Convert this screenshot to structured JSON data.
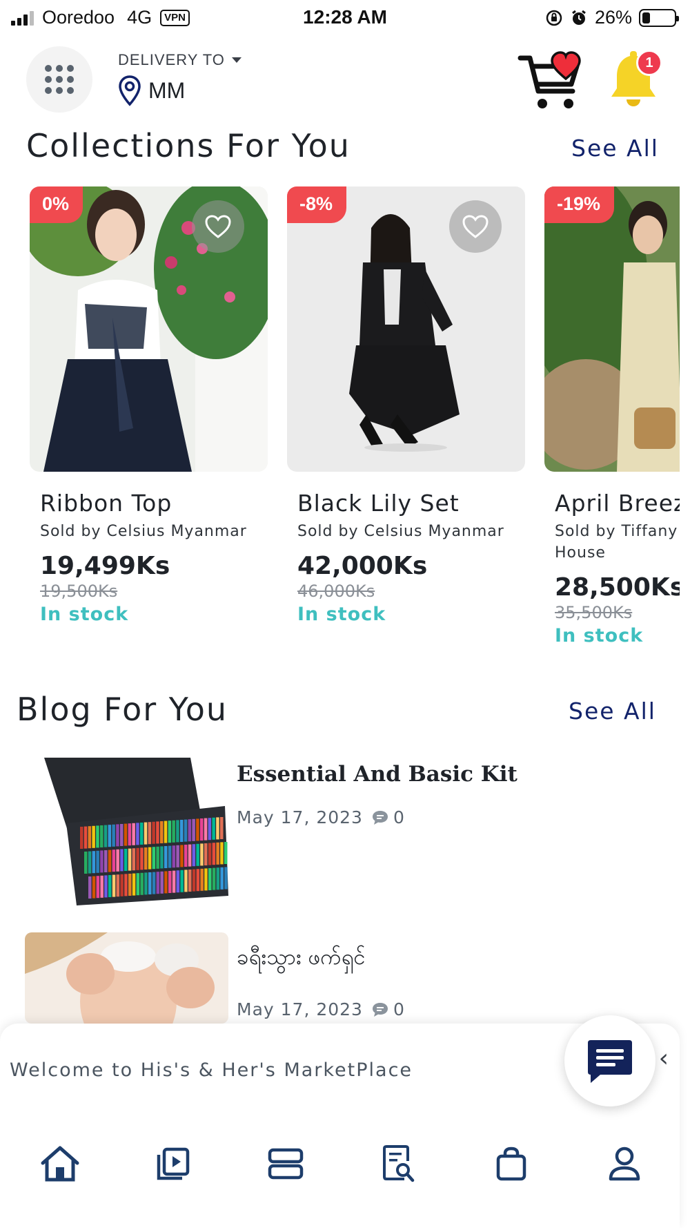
{
  "status_bar": {
    "carrier": "Ooredoo",
    "network": "4G",
    "vpn": "VPN",
    "time": "12:28 AM",
    "battery": "26%",
    "battery_level": 0.26
  },
  "header": {
    "delivery_label": "DELIVERY TO",
    "location": "MM",
    "notification_count": "1"
  },
  "collections": {
    "title": "Collections For You",
    "see_all": "See All",
    "items": [
      {
        "discount": "0%",
        "name": "Ribbon Top",
        "seller": "Sold by  Celsius Myanmar",
        "price": "19,499Ks",
        "old_price": "19,500Ks",
        "stock": "In stock"
      },
      {
        "discount": "-8%",
        "name": "Black Lily Set",
        "seller": "Sold by  Celsius Myanmar",
        "price": "42,000Ks",
        "old_price": "46,000Ks",
        "stock": "In stock"
      },
      {
        "discount": "-19%",
        "name": "April Breez",
        "seller": "Sold by Tiffany House",
        "price": "28,500Ks",
        "old_price": "35,500Ks",
        "stock": "In stock"
      }
    ]
  },
  "blog": {
    "title": "Blog For You",
    "see_all": "See All",
    "items": [
      {
        "title": "Essential And Basic Kit",
        "date": "May 17, 2023",
        "comments": "0"
      },
      {
        "title": "ခရီးသွား ဖက်ရှင်",
        "date": "May 17, 2023",
        "comments": "0"
      }
    ]
  },
  "welcome": {
    "text": "Welcome to His's & Her's MarketPlace",
    "close": "‹"
  },
  "colors": {
    "discount": "#f04a4f",
    "stock": "#3fbfbf",
    "see_all": "#12236b",
    "nav_icons": "#1d3d6b",
    "badge": "#ee3a4e"
  },
  "bottom_nav": [
    "home-icon",
    "video-icon",
    "list-icon",
    "blog-search-icon",
    "bag-icon",
    "profile-icon"
  ]
}
